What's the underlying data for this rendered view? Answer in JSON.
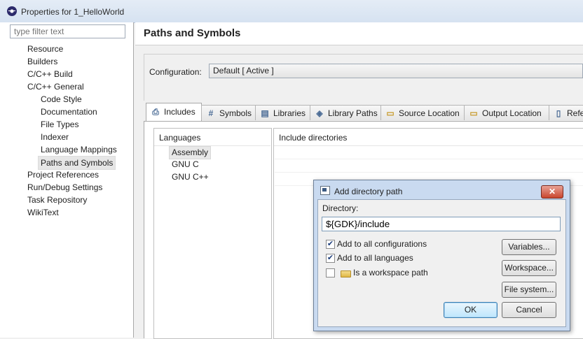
{
  "window": {
    "title": "Properties for 1_HelloWorld",
    "icon": "eclipse-icon"
  },
  "filter": {
    "placeholder": "type filter text"
  },
  "tree": {
    "items": [
      {
        "label": "Resource"
      },
      {
        "label": "Builders"
      },
      {
        "label": "C/C++ Build"
      },
      {
        "label": "C/C++ General"
      },
      {
        "label": "Code Style"
      },
      {
        "label": "Documentation"
      },
      {
        "label": "File Types"
      },
      {
        "label": "Indexer"
      },
      {
        "label": "Language Mappings"
      },
      {
        "label": "Paths and Symbols",
        "selected": true
      },
      {
        "label": "Project References"
      },
      {
        "label": "Run/Debug Settings"
      },
      {
        "label": "Task Repository"
      },
      {
        "label": "WikiText"
      }
    ]
  },
  "page": {
    "title": "Paths and Symbols"
  },
  "configuration": {
    "label": "Configuration:",
    "value": "Default  [ Active ]"
  },
  "tabs": [
    {
      "label": "Includes",
      "icon": "includes-icon",
      "active": true
    },
    {
      "label": "Symbols",
      "icon": "hash-icon"
    },
    {
      "label": "Libraries",
      "icon": "library-icon"
    },
    {
      "label": "Library Paths",
      "icon": "library-paths-icon"
    },
    {
      "label": "Source Location",
      "icon": "folder-icon"
    },
    {
      "label": "Output Location",
      "icon": "output-folder-icon"
    },
    {
      "label": "Refe",
      "icon": "references-icon"
    }
  ],
  "languages": {
    "header": "Languages",
    "items": [
      {
        "label": "Assembly",
        "selected": true
      },
      {
        "label": "GNU C"
      },
      {
        "label": "GNU C++"
      }
    ]
  },
  "includes": {
    "header": "Include directories"
  },
  "dialog": {
    "title": "Add directory path",
    "close_label": "✕",
    "directory_label": "Directory:",
    "directory_value": "${GDK}/include",
    "add_all_configs": {
      "label": "Add to all configurations",
      "checked": true
    },
    "add_all_langs": {
      "label": "Add to all languages",
      "checked": true
    },
    "workspace_path": {
      "label": "Is a workspace path",
      "checked": false
    },
    "buttons": {
      "variables": "Variables...",
      "workspace": "Workspace...",
      "filesystem": "File system...",
      "ok": "OK",
      "cancel": "Cancel"
    }
  }
}
